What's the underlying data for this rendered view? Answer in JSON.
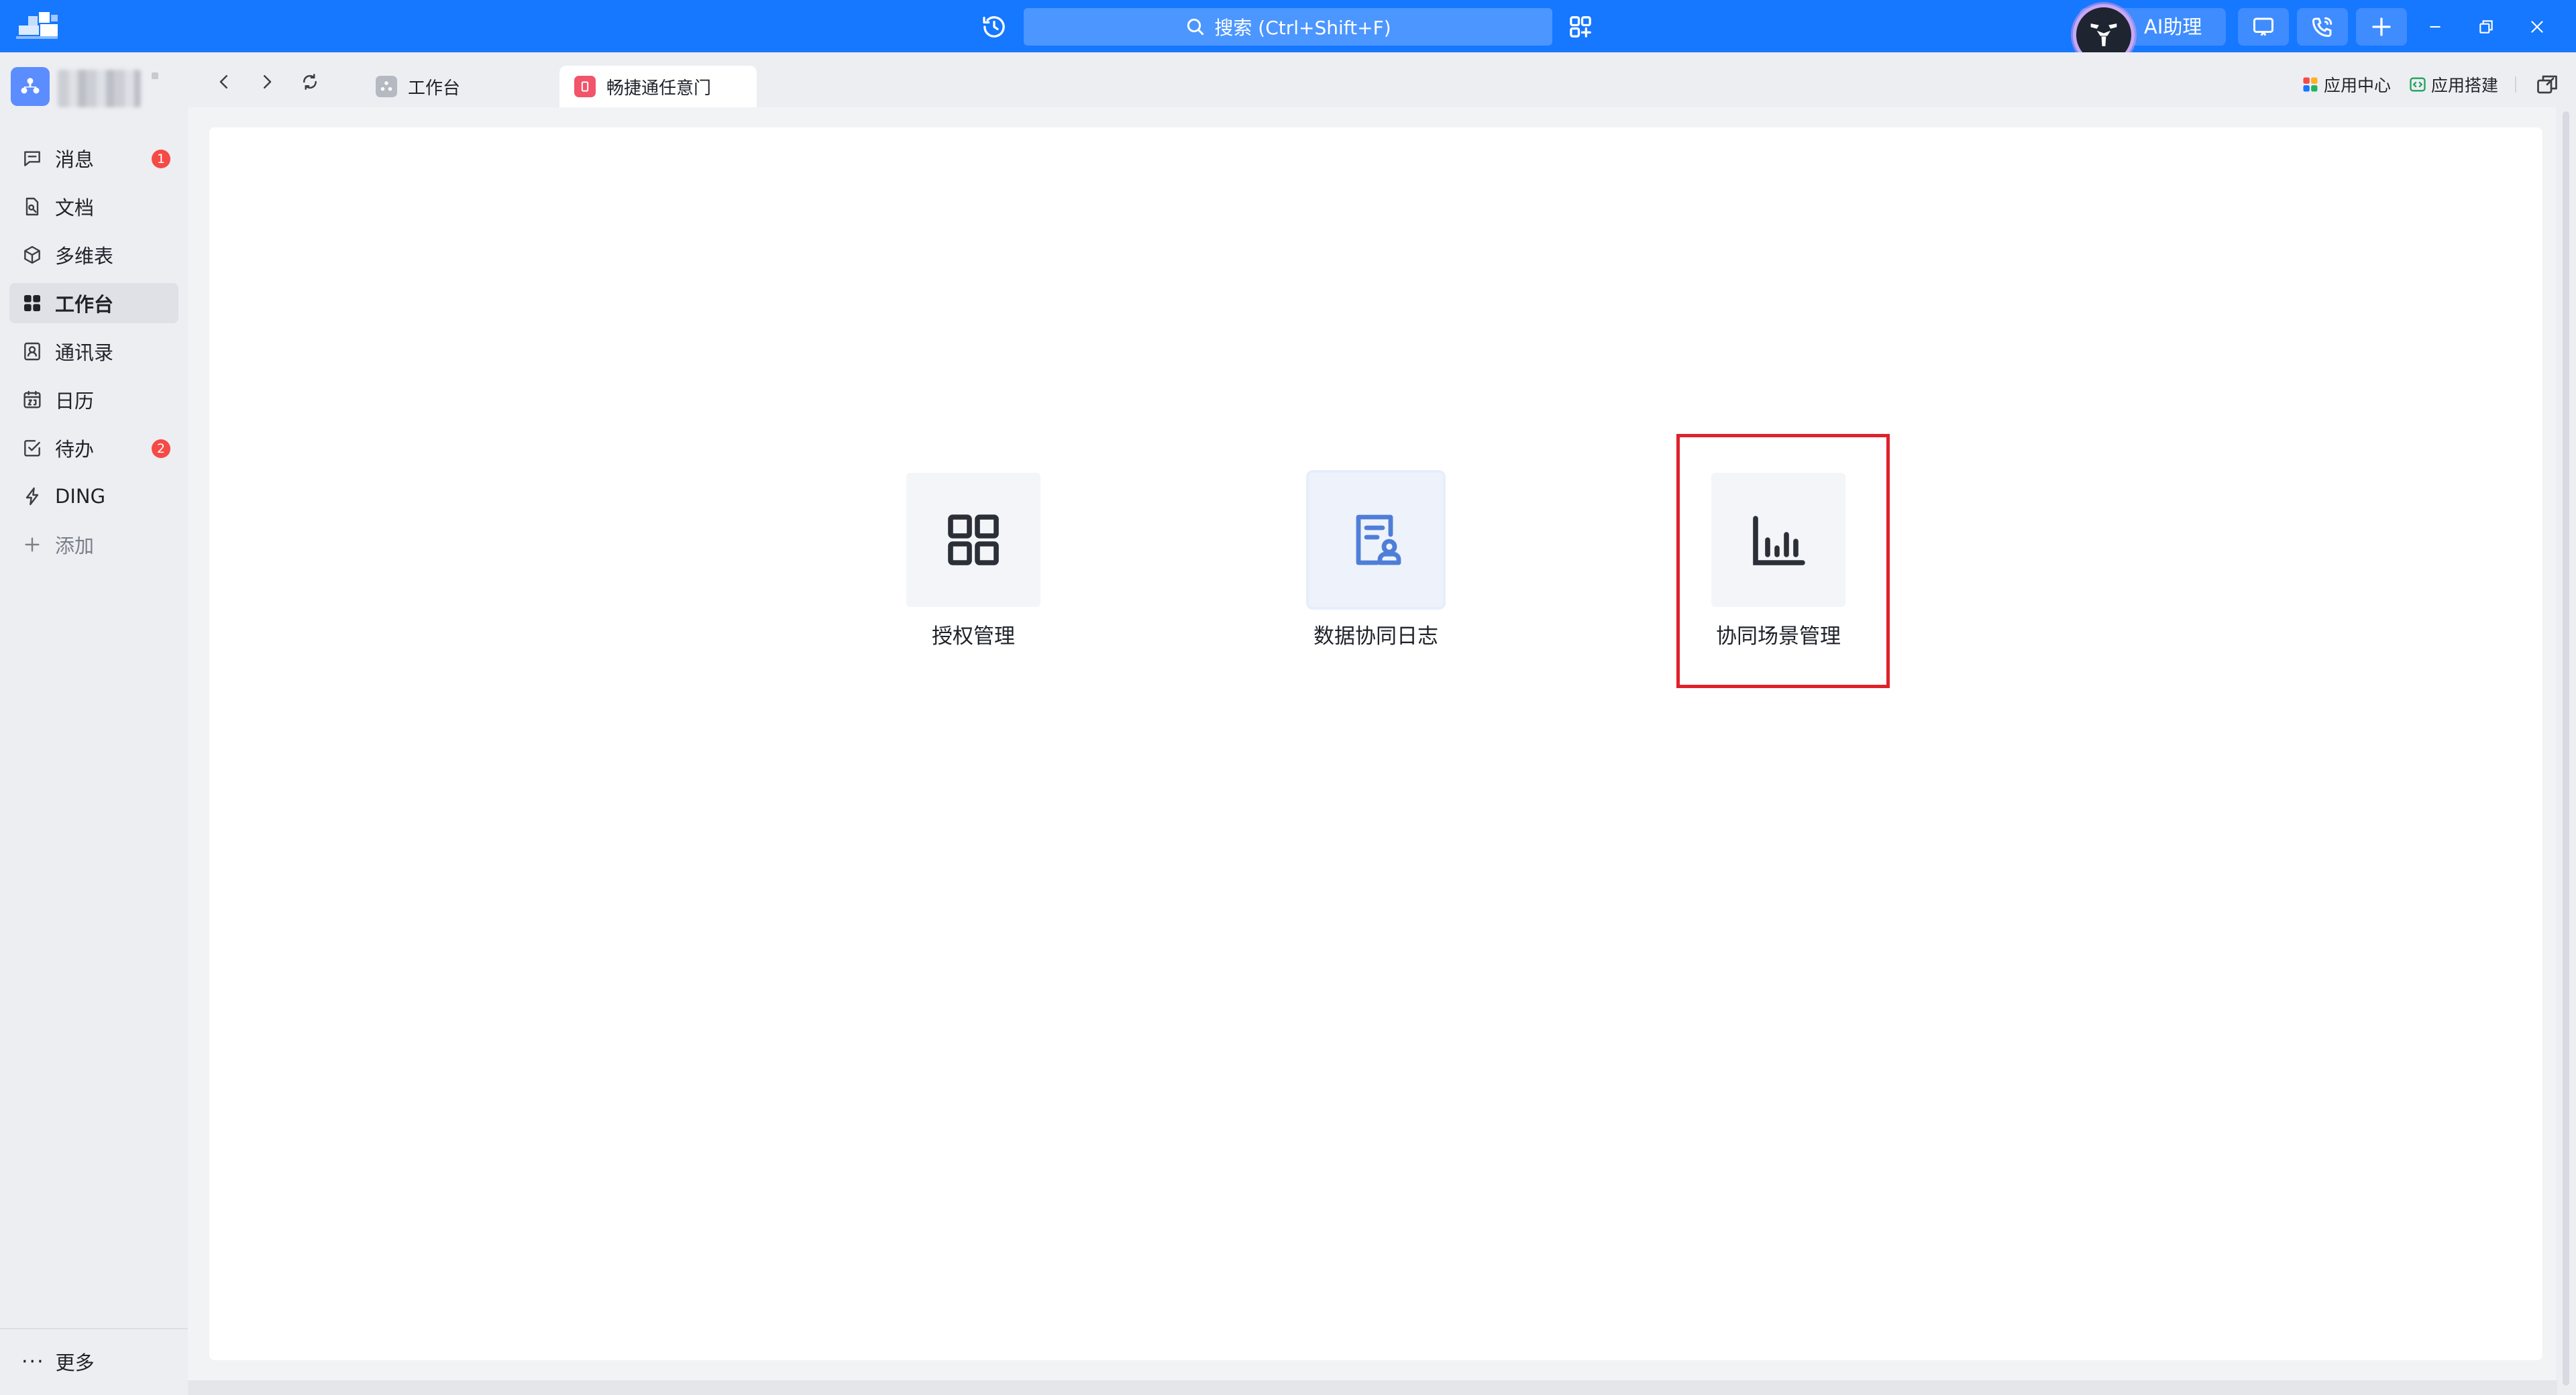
{
  "titlebar": {
    "search_placeholder": "搜索 (Ctrl+Shift+F)",
    "ai_label": "AI助理",
    "accent_color": "#1677ff"
  },
  "sidebar": {
    "items": [
      {
        "label": "消息",
        "icon": "message-icon",
        "badge": "1"
      },
      {
        "label": "文档",
        "icon": "document-icon",
        "badge": ""
      },
      {
        "label": "多维表",
        "icon": "cube-icon",
        "badge": ""
      },
      {
        "label": "工作台",
        "icon": "grid-icon",
        "badge": "",
        "active": true
      },
      {
        "label": "通讯录",
        "icon": "contacts-icon",
        "badge": ""
      },
      {
        "label": "日历",
        "icon": "calendar-icon",
        "badge": ""
      },
      {
        "label": "待办",
        "icon": "checkbox-icon",
        "badge": "2"
      },
      {
        "label": "DING",
        "icon": "lightning-icon",
        "badge": ""
      },
      {
        "label": "添加",
        "icon": "plus-icon",
        "badge": ""
      }
    ],
    "more_label": "更多"
  },
  "tabs": [
    {
      "label": "工作台",
      "active": false
    },
    {
      "label": "畅捷通任意门",
      "active": true
    }
  ],
  "toolbar": {
    "app_center_label": "应用中心",
    "app_builder_label": "应用搭建"
  },
  "apps": [
    {
      "label": "授权管理",
      "icon": "grid-four-icon"
    },
    {
      "label": "数据协同日志",
      "icon": "document-user-icon"
    },
    {
      "label": "协同场景管理",
      "icon": "bar-chart-icon",
      "highlighted": true
    }
  ]
}
